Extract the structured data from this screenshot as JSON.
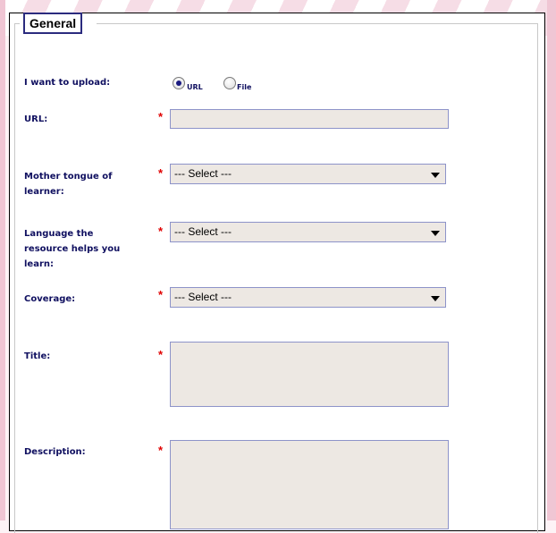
{
  "form": {
    "legend": "General",
    "upload_label": "I want to upload:",
    "upload_options": [
      {
        "label": "URL",
        "selected": true
      },
      {
        "label": "File",
        "selected": false
      }
    ],
    "url_label": "URL:",
    "url_value": "",
    "mother_tongue_label": "Mother tongue of learner:",
    "mother_tongue_value": "--- Select ---",
    "language_label": "Language the resource helps you learn:",
    "language_value": "--- Select ---",
    "coverage_label": "Coverage:",
    "coverage_value": "--- Select ---",
    "title_label": "Title:",
    "title_value": "",
    "description_label": "Description:",
    "description_value": "",
    "required_mark": "*"
  },
  "colors": {
    "label": "#101060",
    "required": "#e00000",
    "field_bg": "#ede8e3",
    "field_border": "#8d93c9",
    "legend_border": "#2b2b7e"
  }
}
